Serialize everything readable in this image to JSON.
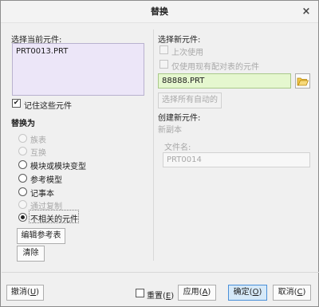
{
  "window": {
    "title": "替换",
    "close_glyph": "×"
  },
  "left": {
    "current_label": "选择当前元件:",
    "current_items": [
      "PRT0013.PRT"
    ],
    "remember": {
      "label": "记住这些元件",
      "checked": true
    },
    "replace_with_label": "替换为",
    "options": [
      {
        "label": "族表",
        "enabled": false,
        "selected": false
      },
      {
        "label": "互换",
        "enabled": false,
        "selected": false
      },
      {
        "label": "模块或模块变型",
        "enabled": true,
        "selected": false
      },
      {
        "label": "参考模型",
        "enabled": true,
        "selected": false
      },
      {
        "label": "记事本",
        "enabled": true,
        "selected": false
      },
      {
        "label": "通过复制",
        "enabled": false,
        "selected": false
      },
      {
        "label": "不相关的元件",
        "enabled": true,
        "selected": true
      }
    ],
    "edit_ref_button": "编辑参考表",
    "clear_button": "清除"
  },
  "right": {
    "new_label": "选择新元件:",
    "last_used": {
      "label": "上次使用",
      "enabled": false
    },
    "paired_only": {
      "label": "仅使用现有配对表的元件",
      "enabled": false
    },
    "new_value": "88888.PRT",
    "select_all_auto_button": "选择所有自动的",
    "create_label": "创建新元件:",
    "new_copy_label": "新副本",
    "filename_label": "文件名:",
    "filename_value": "PRT0014"
  },
  "footer": {
    "undo_button": "撤消(",
    "undo_key": "U",
    "reset": {
      "label": "重置(",
      "key": "E",
      "checked": false
    },
    "apply_label": "应用(",
    "apply_key": "A",
    "ok_label": "确定(",
    "ok_key": "O",
    "cancel_label": "取消(",
    "cancel_key": "C",
    "paren_close": ")"
  },
  "icons": {
    "folder": "folder-open-icon"
  }
}
